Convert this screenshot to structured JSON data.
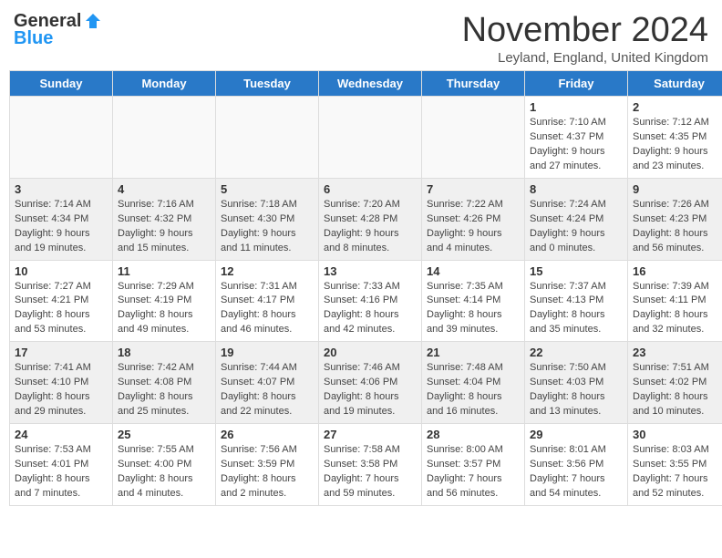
{
  "header": {
    "logo_general": "General",
    "logo_blue": "Blue",
    "month_title": "November 2024",
    "location": "Leyland, England, United Kingdom"
  },
  "weekdays": [
    "Sunday",
    "Monday",
    "Tuesday",
    "Wednesday",
    "Thursday",
    "Friday",
    "Saturday"
  ],
  "weeks": [
    [
      {
        "day": "",
        "sunrise": "",
        "sunset": "",
        "daylight": ""
      },
      {
        "day": "",
        "sunrise": "",
        "sunset": "",
        "daylight": ""
      },
      {
        "day": "",
        "sunrise": "",
        "sunset": "",
        "daylight": ""
      },
      {
        "day": "",
        "sunrise": "",
        "sunset": "",
        "daylight": ""
      },
      {
        "day": "",
        "sunrise": "",
        "sunset": "",
        "daylight": ""
      },
      {
        "day": "1",
        "sunrise": "Sunrise: 7:10 AM",
        "sunset": "Sunset: 4:37 PM",
        "daylight": "Daylight: 9 hours and 27 minutes."
      },
      {
        "day": "2",
        "sunrise": "Sunrise: 7:12 AM",
        "sunset": "Sunset: 4:35 PM",
        "daylight": "Daylight: 9 hours and 23 minutes."
      }
    ],
    [
      {
        "day": "3",
        "sunrise": "Sunrise: 7:14 AM",
        "sunset": "Sunset: 4:34 PM",
        "daylight": "Daylight: 9 hours and 19 minutes."
      },
      {
        "day": "4",
        "sunrise": "Sunrise: 7:16 AM",
        "sunset": "Sunset: 4:32 PM",
        "daylight": "Daylight: 9 hours and 15 minutes."
      },
      {
        "day": "5",
        "sunrise": "Sunrise: 7:18 AM",
        "sunset": "Sunset: 4:30 PM",
        "daylight": "Daylight: 9 hours and 11 minutes."
      },
      {
        "day": "6",
        "sunrise": "Sunrise: 7:20 AM",
        "sunset": "Sunset: 4:28 PM",
        "daylight": "Daylight: 9 hours and 8 minutes."
      },
      {
        "day": "7",
        "sunrise": "Sunrise: 7:22 AM",
        "sunset": "Sunset: 4:26 PM",
        "daylight": "Daylight: 9 hours and 4 minutes."
      },
      {
        "day": "8",
        "sunrise": "Sunrise: 7:24 AM",
        "sunset": "Sunset: 4:24 PM",
        "daylight": "Daylight: 9 hours and 0 minutes."
      },
      {
        "day": "9",
        "sunrise": "Sunrise: 7:26 AM",
        "sunset": "Sunset: 4:23 PM",
        "daylight": "Daylight: 8 hours and 56 minutes."
      }
    ],
    [
      {
        "day": "10",
        "sunrise": "Sunrise: 7:27 AM",
        "sunset": "Sunset: 4:21 PM",
        "daylight": "Daylight: 8 hours and 53 minutes."
      },
      {
        "day": "11",
        "sunrise": "Sunrise: 7:29 AM",
        "sunset": "Sunset: 4:19 PM",
        "daylight": "Daylight: 8 hours and 49 minutes."
      },
      {
        "day": "12",
        "sunrise": "Sunrise: 7:31 AM",
        "sunset": "Sunset: 4:17 PM",
        "daylight": "Daylight: 8 hours and 46 minutes."
      },
      {
        "day": "13",
        "sunrise": "Sunrise: 7:33 AM",
        "sunset": "Sunset: 4:16 PM",
        "daylight": "Daylight: 8 hours and 42 minutes."
      },
      {
        "day": "14",
        "sunrise": "Sunrise: 7:35 AM",
        "sunset": "Sunset: 4:14 PM",
        "daylight": "Daylight: 8 hours and 39 minutes."
      },
      {
        "day": "15",
        "sunrise": "Sunrise: 7:37 AM",
        "sunset": "Sunset: 4:13 PM",
        "daylight": "Daylight: 8 hours and 35 minutes."
      },
      {
        "day": "16",
        "sunrise": "Sunrise: 7:39 AM",
        "sunset": "Sunset: 4:11 PM",
        "daylight": "Daylight: 8 hours and 32 minutes."
      }
    ],
    [
      {
        "day": "17",
        "sunrise": "Sunrise: 7:41 AM",
        "sunset": "Sunset: 4:10 PM",
        "daylight": "Daylight: 8 hours and 29 minutes."
      },
      {
        "day": "18",
        "sunrise": "Sunrise: 7:42 AM",
        "sunset": "Sunset: 4:08 PM",
        "daylight": "Daylight: 8 hours and 25 minutes."
      },
      {
        "day": "19",
        "sunrise": "Sunrise: 7:44 AM",
        "sunset": "Sunset: 4:07 PM",
        "daylight": "Daylight: 8 hours and 22 minutes."
      },
      {
        "day": "20",
        "sunrise": "Sunrise: 7:46 AM",
        "sunset": "Sunset: 4:06 PM",
        "daylight": "Daylight: 8 hours and 19 minutes."
      },
      {
        "day": "21",
        "sunrise": "Sunrise: 7:48 AM",
        "sunset": "Sunset: 4:04 PM",
        "daylight": "Daylight: 8 hours and 16 minutes."
      },
      {
        "day": "22",
        "sunrise": "Sunrise: 7:50 AM",
        "sunset": "Sunset: 4:03 PM",
        "daylight": "Daylight: 8 hours and 13 minutes."
      },
      {
        "day": "23",
        "sunrise": "Sunrise: 7:51 AM",
        "sunset": "Sunset: 4:02 PM",
        "daylight": "Daylight: 8 hours and 10 minutes."
      }
    ],
    [
      {
        "day": "24",
        "sunrise": "Sunrise: 7:53 AM",
        "sunset": "Sunset: 4:01 PM",
        "daylight": "Daylight: 8 hours and 7 minutes."
      },
      {
        "day": "25",
        "sunrise": "Sunrise: 7:55 AM",
        "sunset": "Sunset: 4:00 PM",
        "daylight": "Daylight: 8 hours and 4 minutes."
      },
      {
        "day": "26",
        "sunrise": "Sunrise: 7:56 AM",
        "sunset": "Sunset: 3:59 PM",
        "daylight": "Daylight: 8 hours and 2 minutes."
      },
      {
        "day": "27",
        "sunrise": "Sunrise: 7:58 AM",
        "sunset": "Sunset: 3:58 PM",
        "daylight": "Daylight: 7 hours and 59 minutes."
      },
      {
        "day": "28",
        "sunrise": "Sunrise: 8:00 AM",
        "sunset": "Sunset: 3:57 PM",
        "daylight": "Daylight: 7 hours and 56 minutes."
      },
      {
        "day": "29",
        "sunrise": "Sunrise: 8:01 AM",
        "sunset": "Sunset: 3:56 PM",
        "daylight": "Daylight: 7 hours and 54 minutes."
      },
      {
        "day": "30",
        "sunrise": "Sunrise: 8:03 AM",
        "sunset": "Sunset: 3:55 PM",
        "daylight": "Daylight: 7 hours and 52 minutes."
      }
    ]
  ]
}
